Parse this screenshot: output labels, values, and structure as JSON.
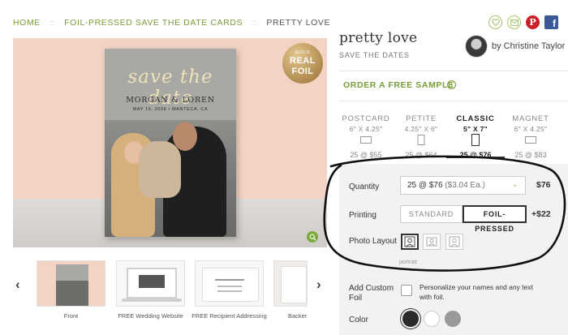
{
  "breadcrumb": {
    "home": "HOME",
    "category": "FOIL-PRESSED SAVE THE DATE CARDS",
    "current": "PRETTY LOVE",
    "separator": "::"
  },
  "social_icons": [
    "heart-icon",
    "mail-icon",
    "pinterest-icon",
    "facebook-icon"
  ],
  "hero": {
    "card_script": "save the date",
    "card_names": "MORGAN & LOREN",
    "card_date": "MAY 16, 2008 • MANTECA, CA",
    "badge": {
      "line1": "GOLD",
      "line2": "REAL",
      "line3": "FOIL"
    }
  },
  "thumbnails": [
    {
      "label": "Front"
    },
    {
      "label": "FREE Wedding Website"
    },
    {
      "label": "FREE Recipient Addressing"
    },
    {
      "label": "Backer"
    }
  ],
  "product": {
    "title": "pretty love",
    "subtitle": "SAVE THE DATES",
    "designer": "by Christine Taylor",
    "sample_link": "ORDER A FREE SAMPLE"
  },
  "sizes": [
    {
      "name": "POSTCARD",
      "dims": "6\" X 4.25\"",
      "price": "25 @ $55",
      "selected": false
    },
    {
      "name": "PETITE",
      "dims": "4.25\" X 6\"",
      "price": "25 @ $64",
      "selected": false
    },
    {
      "name": "CLASSIC",
      "dims": "5\" X 7\"",
      "price": "25 @ $76",
      "selected": true
    },
    {
      "name": "MAGNET",
      "dims": "6\" X 4.25\"",
      "price": "25 @ $83",
      "selected": false
    }
  ],
  "options": {
    "quantity_label": "Quantity",
    "quantity_value": "25 @ $76",
    "quantity_each": "($3.04 Ea.)",
    "quantity_total": "$76",
    "printing_label": "Printing",
    "printing_standard": "STANDARD",
    "printing_foil": "FOIL-PRESSED",
    "printing_add": "+$22",
    "layout_label": "Photo Layout",
    "layout_caption": "portrait",
    "custom_foil_label_1": "Add Custom",
    "custom_foil_label_2": "Foil",
    "custom_foil_desc": "Personalize your names and any text with foil.",
    "color_label": "Color"
  },
  "colors": {
    "accent_green": "#7a9d3a",
    "swatches": [
      "#2b2b2b",
      "#ffffff",
      "#9a9a9a"
    ]
  }
}
